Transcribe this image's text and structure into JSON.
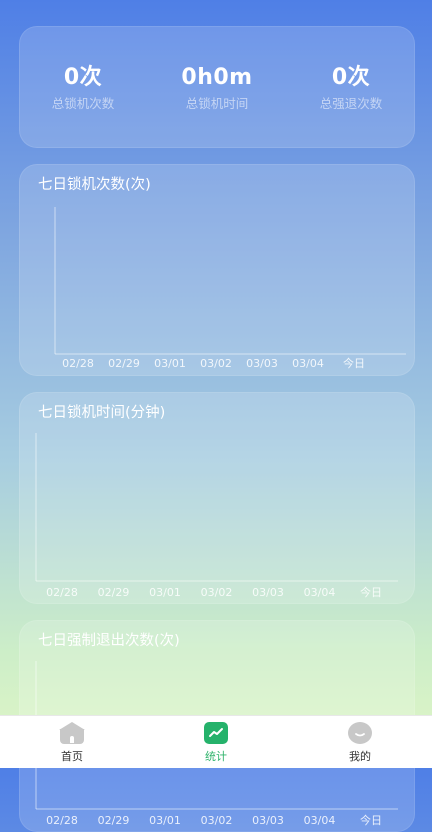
{
  "summary": {
    "lock_count": {
      "value": "0次",
      "label": "总锁机次数"
    },
    "lock_time": {
      "value": "0h0m",
      "label": "总锁机时间"
    },
    "force_exit": {
      "value": "0次",
      "label": "总强退次数"
    }
  },
  "charts": [
    {
      "title": "七日锁机次数(次)",
      "dates": [
        "02/28",
        "02/29",
        "03/01",
        "03/02",
        "03/03",
        "03/04",
        "今日"
      ]
    },
    {
      "title": "七日锁机时间(分钟)",
      "dates": [
        "02/28",
        "02/29",
        "03/01",
        "03/02",
        "03/03",
        "03/04",
        "今日"
      ]
    },
    {
      "title": "七日强制退出次数(次)",
      "dates": [
        "02/28",
        "02/29",
        "03/01",
        "03/02",
        "03/03",
        "03/04",
        "今日"
      ]
    }
  ],
  "chart_data": [
    {
      "type": "line",
      "title": "七日锁机次数(次)",
      "categories": [
        "02/28",
        "02/29",
        "03/01",
        "03/02",
        "03/03",
        "03/04",
        "今日"
      ],
      "values": []
    },
    {
      "type": "line",
      "title": "七日锁机时间(分钟)",
      "categories": [
        "02/28",
        "02/29",
        "03/01",
        "03/02",
        "03/03",
        "03/04",
        "今日"
      ],
      "values": []
    },
    {
      "type": "line",
      "title": "七日强制退出次数(次)",
      "categories": [
        "02/28",
        "02/29",
        "03/01",
        "03/02",
        "03/03",
        "03/04",
        "今日"
      ],
      "values": []
    }
  ],
  "tabbar": {
    "home": {
      "label": "首页",
      "icon": "house-icon"
    },
    "stats": {
      "label": "统计",
      "icon": "stats-icon"
    },
    "mine": {
      "label": "我的",
      "icon": "face-icon"
    }
  },
  "colors": {
    "active": "#2fb36b",
    "tab_icon": "#c8c8c8"
  }
}
